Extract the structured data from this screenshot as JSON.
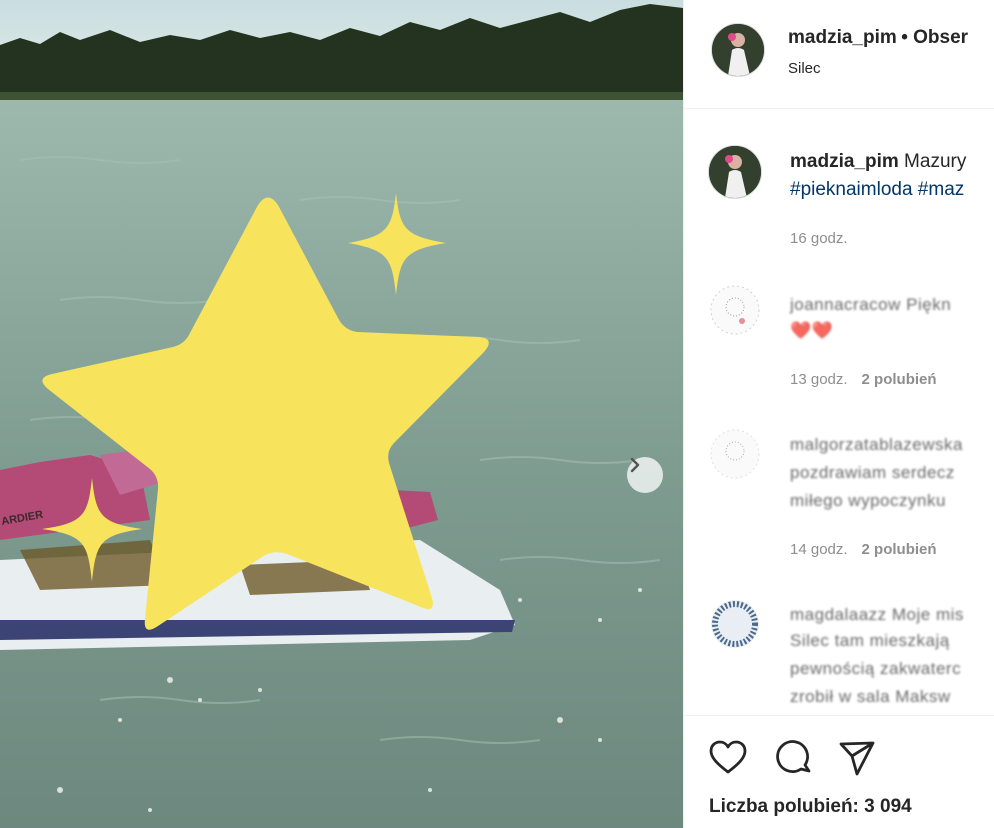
{
  "post": {
    "username": "madzia_pim",
    "follow_label": "• Obser",
    "location": "Silec"
  },
  "caption": {
    "username": "madzia_pim",
    "text": "Mazury",
    "hashtags": "#pieknaimloda #maz",
    "time": "16 godz."
  },
  "comments": [
    {
      "username": "joannacracow",
      "text_line1": "joannacracow Piękn",
      "text_line2": "❤️❤️",
      "time": "13 godz.",
      "likes": "2 polubień"
    },
    {
      "username": "malgorzatabiazowska",
      "text_line1": "malgorzatablazewska",
      "text_line2": "pozdrawiam serdecz",
      "text_line3": "miłego wypoczynku",
      "time": "14 godz.",
      "likes": "2 polubień"
    },
    {
      "username": "magdalaazz",
      "text_line1": "magdalaazz Moje mis",
      "text_line2": "Silec tam mieszkają",
      "text_line3": "pewnością zakwaterc",
      "text_line4": "zrobił w sala Maksw"
    }
  ],
  "likes": {
    "label": "Liczba polubień: 3 094"
  },
  "photo_brand_text": "ARDIER",
  "icons": {
    "next": "chevron-right-icon",
    "like": "heart-icon",
    "comment": "comment-icon",
    "share": "paper-plane-icon"
  },
  "colors": {
    "star": "#f8e45c",
    "link": "#00376b",
    "muted": "#8e8e8e",
    "text": "#262626"
  }
}
